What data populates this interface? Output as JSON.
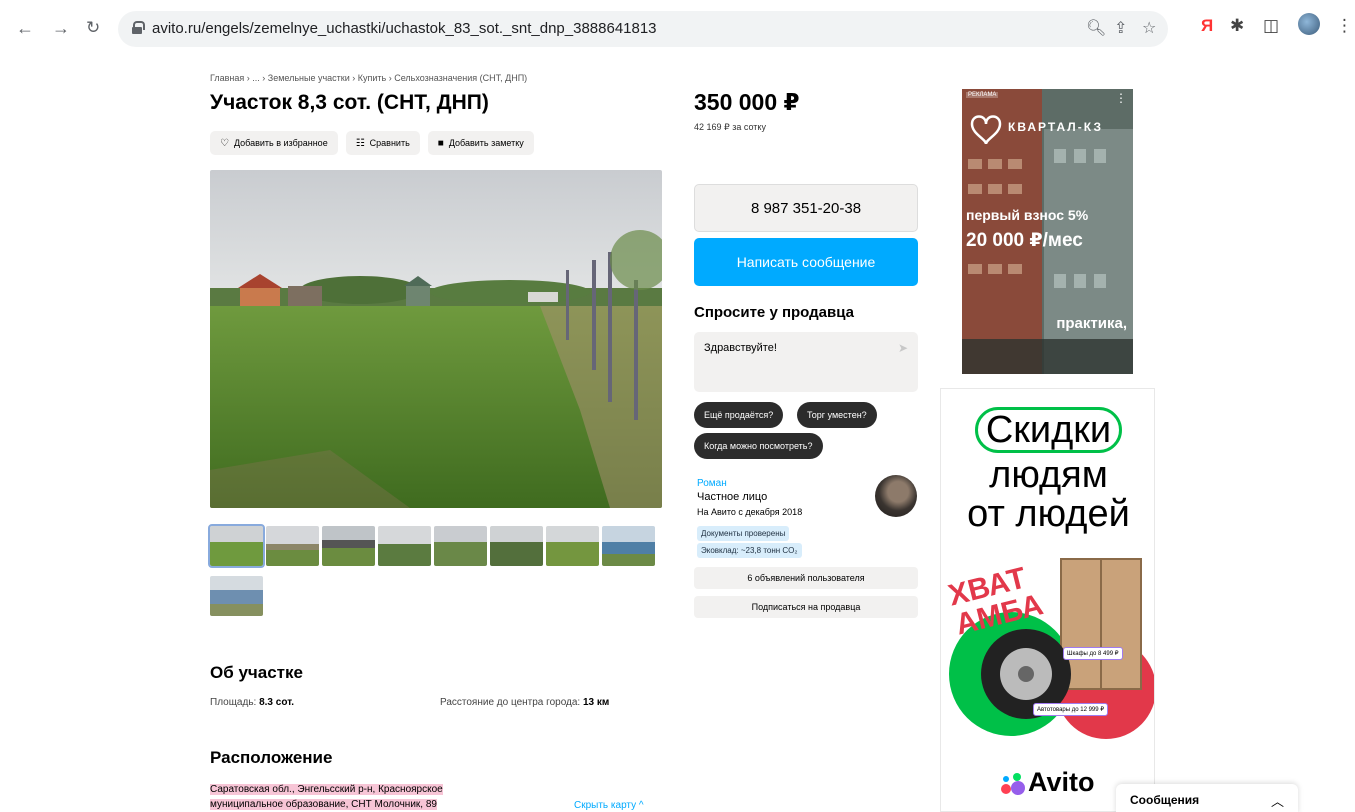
{
  "browser": {
    "url": "avito.ru/engels/zemelnye_uchastki/uchastok_83_sot._snt_dnp_3888641813"
  },
  "breadcrumb": "Главная › ... › Земельные участки › Купить › Сельхозназначения (СНТ, ДНП)",
  "title": "Участок 8,3 сот. (СНТ, ДНП)",
  "actions": {
    "favorite": "Добавить в избранное",
    "compare": "Сравнить",
    "note": "Добавить заметку"
  },
  "price": "350 000 ₽",
  "price_per_unit": "42 169 ₽ за сотку",
  "phone": "8 987 351-20-38",
  "write_message": "Написать сообщение",
  "ask_seller": {
    "title": "Спросите у продавца",
    "message": "Здравствуйте!",
    "chips": [
      "Ещё продаётся?",
      "Торг уместен?",
      "Когда можно посмотреть?"
    ]
  },
  "seller": {
    "name": "Роман",
    "type": "Частное лицо",
    "since": "На Авито с декабря 2018",
    "badge_docs": "Документы проверены",
    "badge_eco": "Эковклад: ~23,8 тонн CO₂",
    "listings": "6 объявлений пользователя",
    "subscribe": "Подписаться на продавца"
  },
  "about": {
    "heading": "Об участке",
    "area_label": "Площадь:",
    "area_value": "8.3 сот.",
    "distance_label": "Расстояние до центра города:",
    "distance_value": "13 км"
  },
  "location": {
    "heading": "Расположение",
    "address_line1": "Саратовская обл., Энгельсский р-н, Красноярское",
    "address_line2": "муниципальное образование, СНТ Молочник, 89",
    "hide_map": "Скрыть карту ^"
  },
  "ad1": {
    "tag": "РЕКЛАМА",
    "brand": "КВАРТАЛ-КЗ",
    "line1": "первый взнос 5%",
    "line2": "20 000 ₽/мес",
    "line3": "практика,"
  },
  "ad2": {
    "line1": "Скидки",
    "line2": "людям",
    "line3": "от людей",
    "promo": "ХВАТ АМБА",
    "tag_wardrobe": "Шкафы до 8 499 ₽",
    "tag_tyres": "Автотовары до 12 999 ₽",
    "logo": "Avito"
  },
  "messages": "Сообщения",
  "colors": {
    "accent": "#00aaff",
    "chip": "#2c2c2c",
    "button_bg": "#f2f1f0",
    "ad_green": "#00c048"
  }
}
